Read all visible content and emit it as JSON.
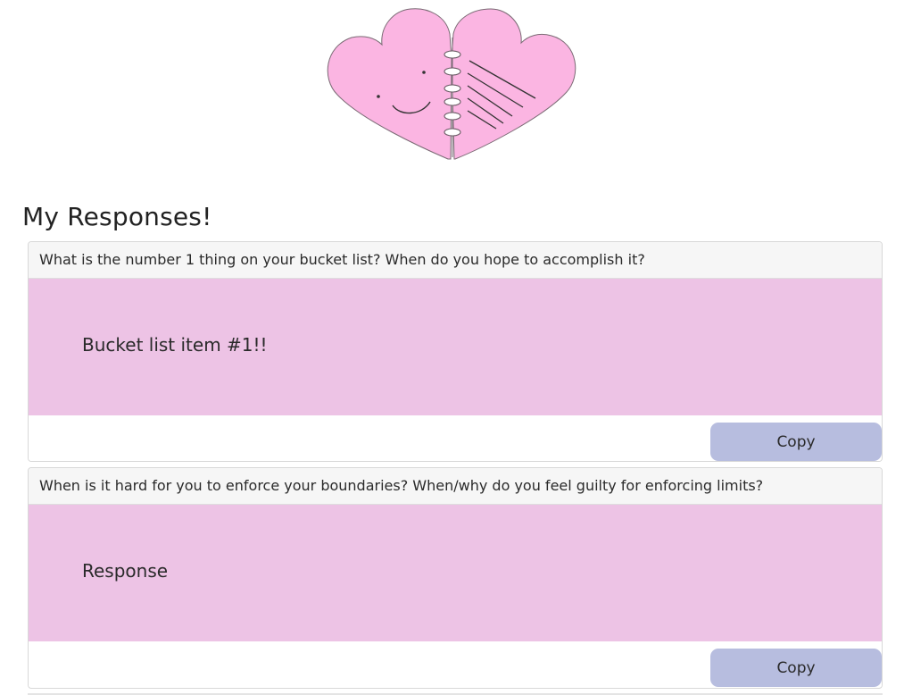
{
  "header": {
    "logo": "heart-notebook-logo"
  },
  "page": {
    "title": "My Responses!"
  },
  "responses": [
    {
      "question": "What is the number 1 thing on your bucket list? When do you hope to accomplish it?",
      "answer": "Bucket list item #1!!",
      "copy_label": "Copy"
    },
    {
      "question": "When is it hard for you to enforce your boundaries? When/why do you feel guilty for enforcing limits?",
      "answer": "Response",
      "copy_label": "Copy"
    }
  ],
  "colors": {
    "heart_fill": "#fbb5e2",
    "answer_background": "#edc3e5",
    "copy_button": "#b7bddf",
    "header_background": "#f6f6f6"
  }
}
